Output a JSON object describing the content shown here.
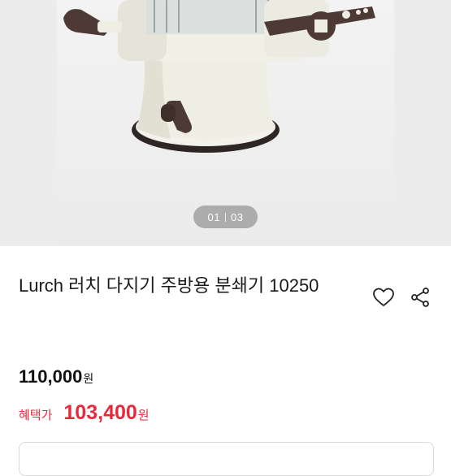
{
  "gallery": {
    "current": "01",
    "total": "03"
  },
  "product": {
    "title": "Lurch 러치 다지기 주방용 분쇄기 10250",
    "price": "110,000",
    "price_unit": "원",
    "benefit_label": "혜택가",
    "benefit_price": "103,400",
    "benefit_unit": "원"
  },
  "icons": {
    "wishlist": "heart-icon",
    "share": "share-icon"
  },
  "colors": {
    "benefit": "#e8283b",
    "product_body": "#efeee3",
    "handle": "#5a4540"
  }
}
